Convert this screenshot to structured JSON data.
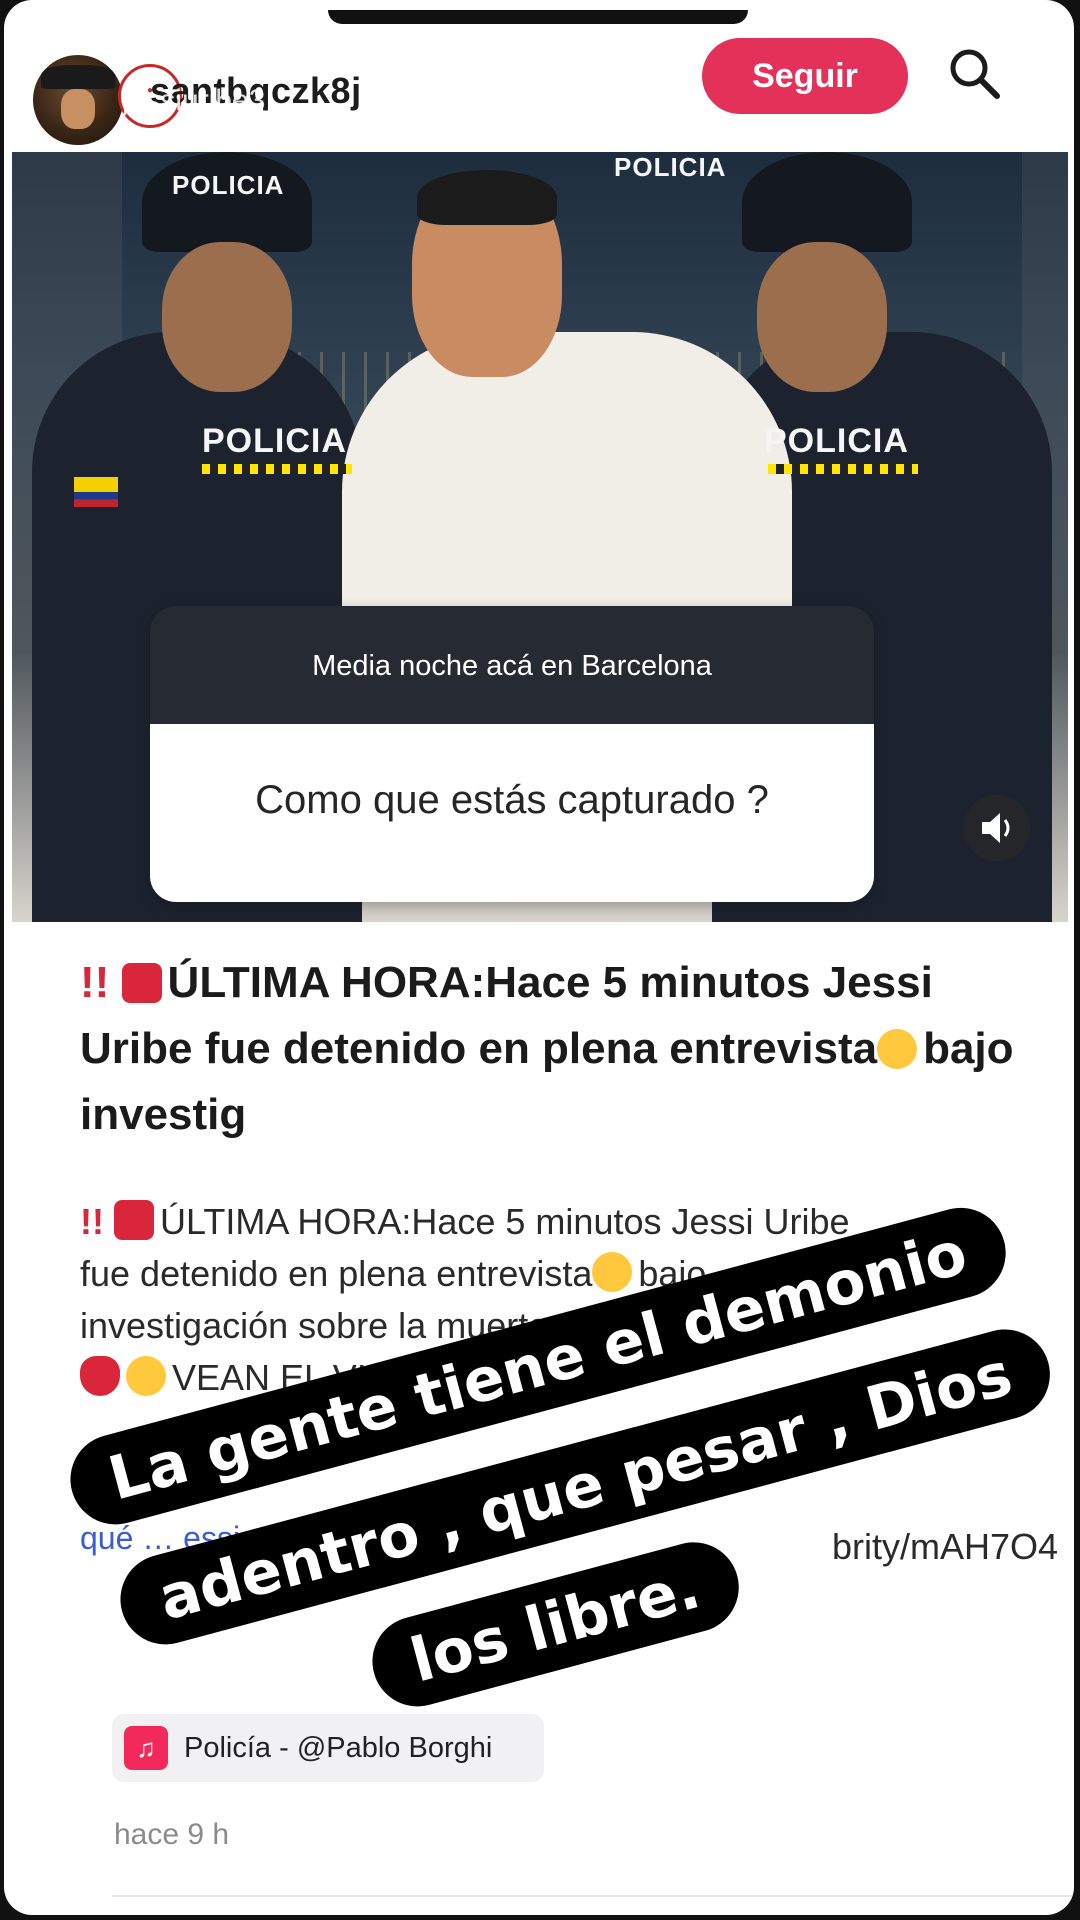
{
  "header": {
    "username": "santbqczk8j",
    "username_overlay": "jessiuribe3",
    "follow_label": "Seguir",
    "overflow_label": "..."
  },
  "photo": {
    "vest_label": "POLICIA",
    "vest_label_right": "POLICIA",
    "cap_label": "POLICIA",
    "cap_label_right": "POLICIA"
  },
  "question": {
    "prompt": "Media noche acá en Barcelona",
    "answer": "Como que estás capturado ?"
  },
  "article": {
    "headline_prefix": "!!",
    "headline": "ÚLTIMA HORA:Hace 5 minutos Jessi Uribe fue detenido en plena entrevista",
    "headline_tail": "bajo investig",
    "body_prefix": "!!",
    "body_line1": "ÚLTIMA HORA:Hace 5 minutos Jessi Uribe",
    "body_line2": "fue detenido en plena entrevista",
    "body_line2_tail": "bajo",
    "body_line3": "investigación sobre la muerte",
    "body_line4": "VEAN EL VID",
    "link_fragment": "brity/mAH7O4",
    "search_link": "qué … essi uribe hoy"
  },
  "overlay_stickers": {
    "line1": "La gente tiene el demonio",
    "line2": "adentro , que pesar , Dios",
    "line3": "los libre."
  },
  "music": {
    "icon": "music-note-icon",
    "label": "Policía - @Pablo Borghi"
  },
  "footer": {
    "time_ago": "hace 9 h"
  },
  "colors": {
    "follow_button": "#e3315a",
    "question_header": "#262a33",
    "link": "#3b5bd9"
  }
}
